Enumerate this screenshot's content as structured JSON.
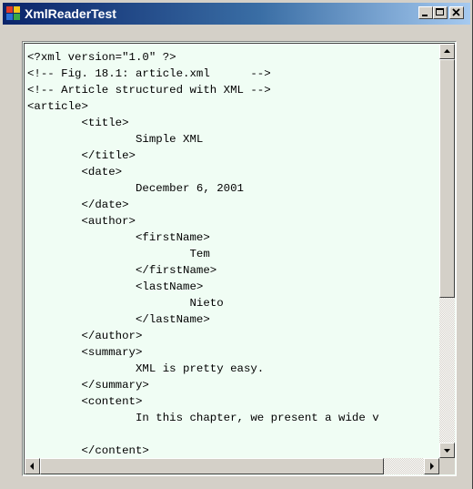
{
  "window": {
    "title": "XmlReaderTest",
    "controls": [
      "minimize-icon",
      "maximize-icon",
      "close-icon"
    ]
  },
  "textbox": {
    "lines": [
      "<?xml version=\"1.0\" ?>",
      "<!-- Fig. 18.1: article.xml      -->",
      "<!-- Article structured with XML -->",
      "<article>",
      "        <title>",
      "                Simple XML",
      "        </title>",
      "        <date>",
      "                December 6, 2001",
      "        </date>",
      "        <author>",
      "                <firstName>",
      "                        Tem",
      "                </firstName>",
      "                <lastName>",
      "                        Nieto",
      "                </lastName>",
      "        </author>",
      "        <summary>",
      "                XML is pretty easy.",
      "        </summary>",
      "        <content>",
      "                In this chapter, we present a wide v",
      "",
      "        </content>"
    ]
  },
  "scrollbars": {
    "vertical_icons": [
      "arrow-up-icon",
      "arrow-down-icon"
    ],
    "horizontal_icons": [
      "arrow-left-icon",
      "arrow-right-icon"
    ]
  },
  "colors": {
    "title_gradient_start": "#0a246a",
    "title_gradient_end": "#a6caf0",
    "text_background": "#f0fdf4",
    "face": "#d4d0c8"
  }
}
